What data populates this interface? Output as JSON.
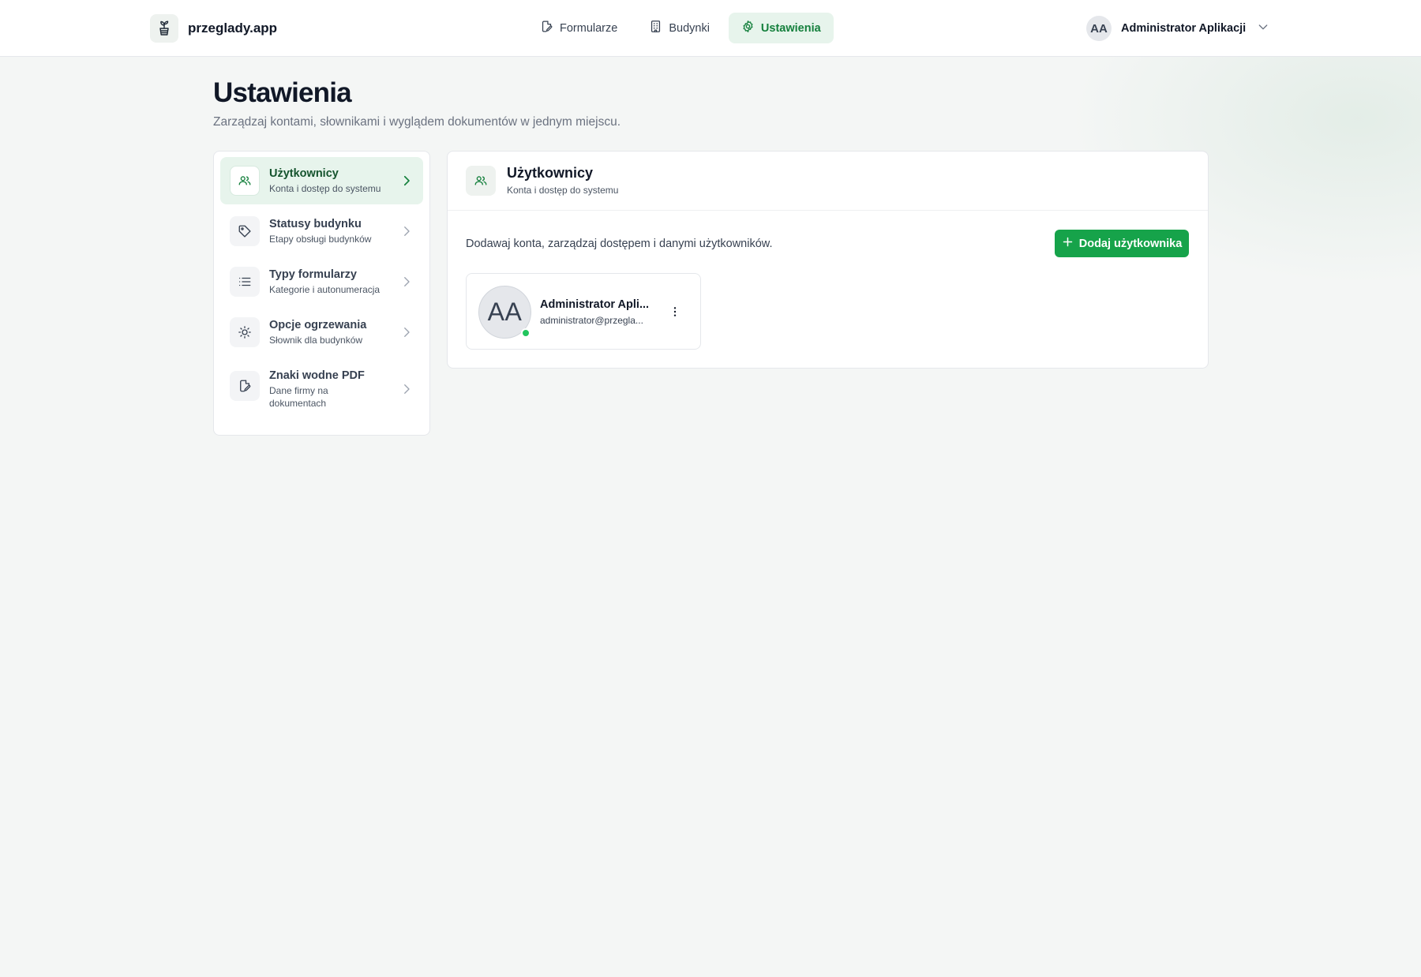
{
  "app": {
    "name": "przeglady.app",
    "accent_color": "#16a34a",
    "accent_bg": "#e7f4ec",
    "logo_icon": "plant-pot-icon"
  },
  "nav": {
    "items": [
      {
        "label": "Formularze",
        "icon": "edit-file-icon",
        "active": false
      },
      {
        "label": "Budynki",
        "icon": "building-icon",
        "active": false
      },
      {
        "label": "Ustawienia",
        "icon": "gear-icon",
        "active": true
      }
    ]
  },
  "user": {
    "initials": "AA",
    "name": "Administrator Aplikacji",
    "menu_icon": "chevron-down-icon"
  },
  "page": {
    "title": "Ustawienia",
    "subtitle": "Zarządzaj kontami, słownikami i wyglądem dokumentów w jednym miejscu."
  },
  "settings_menu": {
    "items": [
      {
        "title": "Użytkownicy",
        "description": "Konta i dostęp do systemu",
        "icon": "users-icon",
        "active": true
      },
      {
        "title": "Statusy budynku",
        "description": "Etapy obsługi budynków",
        "icon": "tag-icon",
        "active": false
      },
      {
        "title": "Typy formularzy",
        "description": "Kategorie i autonumeracja",
        "icon": "list-icon",
        "active": false
      },
      {
        "title": "Opcje ogrzewania",
        "description": "Słownik dla budynków",
        "icon": "sun-icon",
        "active": false
      },
      {
        "title": "Znaki wodne PDF",
        "description": "Dane firmy na dokumentach",
        "icon": "edit-file-icon",
        "active": false
      }
    ]
  },
  "panel": {
    "title": "Użytkownicy",
    "subtitle": "Konta i dostęp do systemu",
    "description": "Dodawaj konta, zarządzaj dostępem i danymi użytkowników.",
    "add_button_label": "Dodaj użytkownika",
    "users": [
      {
        "initials": "AA",
        "name": "Administrator Apli...",
        "email": "administrator@przegla...",
        "status": "online",
        "status_color": "#22c55e"
      }
    ]
  }
}
